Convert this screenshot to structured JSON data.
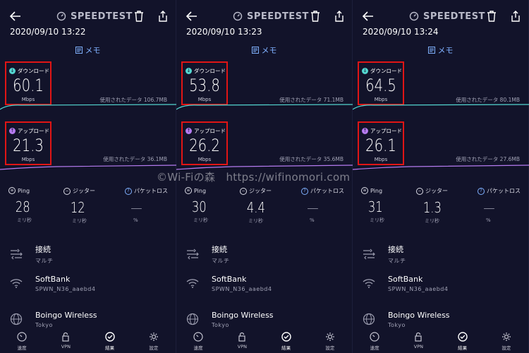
{
  "app_name": "SPEEDTEST",
  "memo_label": "メモ",
  "download_label": "ダウンロード",
  "upload_label": "アップロード",
  "unit_mbps": "Mbps",
  "ping_label": "Ping",
  "jitter_label": "ジッター",
  "loss_label": "パケットロス",
  "ms_unit": "ミリ秒",
  "percent_unit": "%",
  "connection_title": "接続",
  "connection_value": "マルチ",
  "network_name": "SoftBank",
  "network_detail": "SPWN_N36_aaebd4",
  "provider_name": "Boingo Wireless",
  "provider_location": "Tokyo",
  "nav": [
    "速度",
    "VPN",
    "結果",
    "設定"
  ],
  "watermark": "©Wi-Fiの森　https://wifinomori.com",
  "colors": {
    "download": "#53d6d0",
    "upload": "#b57bf0",
    "highlight": "#e01515",
    "memo": "#7fb0ff"
  },
  "results": [
    {
      "date": "2020/09/10 13:22",
      "download": "60.1",
      "upload": "21.3",
      "dl_used": "使用されたデータ 106.7MB",
      "ul_used": "使用されたデータ 36.1MB",
      "ping": "28",
      "jitter": "12",
      "loss": "—"
    },
    {
      "date": "2020/09/10 13:23",
      "download": "53.8",
      "upload": "26.2",
      "dl_used": "使用されたデータ 71.1MB",
      "ul_used": "使用されたデータ 35.6MB",
      "ping": "30",
      "jitter": "4.4",
      "loss": "—"
    },
    {
      "date": "2020/09/10 13:24",
      "download": "64.5",
      "upload": "26.1",
      "dl_used": "使用されたデータ 80.1MB",
      "ul_used": "使用されたデータ 27.6MB",
      "ping": "31",
      "jitter": "1.3",
      "loss": "—"
    }
  ]
}
